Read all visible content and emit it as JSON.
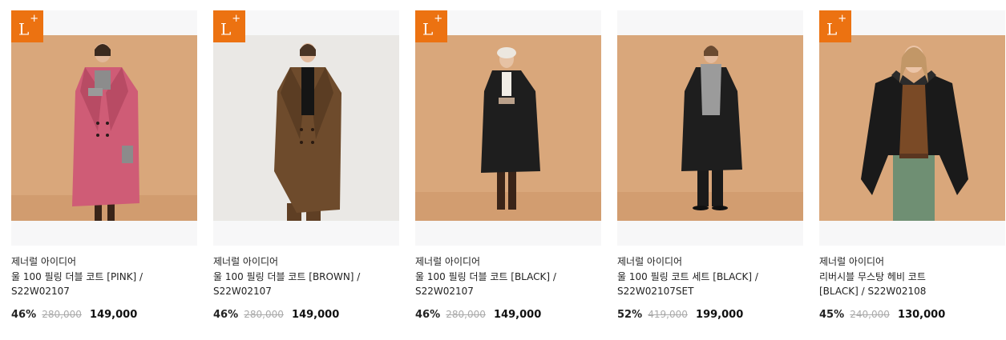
{
  "badge": {
    "letter": "L",
    "sup": "+"
  },
  "colors": {
    "badge": "#ec7211",
    "pink_coat": "#cf5c76",
    "brown_coat": "#6e4b2c",
    "black_coat": "#1e1e1e",
    "backdrop_warm": "#d9a77b",
    "backdrop_light": "#eae8e5"
  },
  "products": [
    {
      "brand": "제너럴 아이디어",
      "name_line1": "울 100 필링 더블 코트 [PINK] /",
      "name_line2": "S22W02107",
      "discount": "46%",
      "original_price": "280,000",
      "sale_price": "149,000",
      "image_icon": "model-pink-coat-photo"
    },
    {
      "brand": "제너럴 아이디어",
      "name_line1": "울 100 필링 더블 코트 [BROWN] /",
      "name_line2": "S22W02107",
      "discount": "46%",
      "original_price": "280,000",
      "sale_price": "149,000",
      "image_icon": "model-brown-coat-photo"
    },
    {
      "brand": "제너럴 아이디어",
      "name_line1": "울 100 필링 더블 코트 [BLACK] /",
      "name_line2": "S22W02107",
      "discount": "46%",
      "original_price": "280,000",
      "sale_price": "149,000",
      "image_icon": "model-black-coat-photo"
    },
    {
      "brand": "제너럴 아이디어",
      "name_line1": "울 100 필링 코트 세트 [BLACK] /",
      "name_line2": "S22W02107SET",
      "discount": "52%",
      "original_price": "419,000",
      "sale_price": "199,000",
      "image_icon": "model-black-coat-set-photo"
    },
    {
      "brand": "제너럴 아이디어",
      "name_line1": "리버시블 무스탕 헤비 코트",
      "name_line2": "[BLACK] / S22W02108",
      "discount": "45%",
      "original_price": "240,000",
      "sale_price": "130,000",
      "image_icon": "model-mustang-coat-photo"
    }
  ]
}
